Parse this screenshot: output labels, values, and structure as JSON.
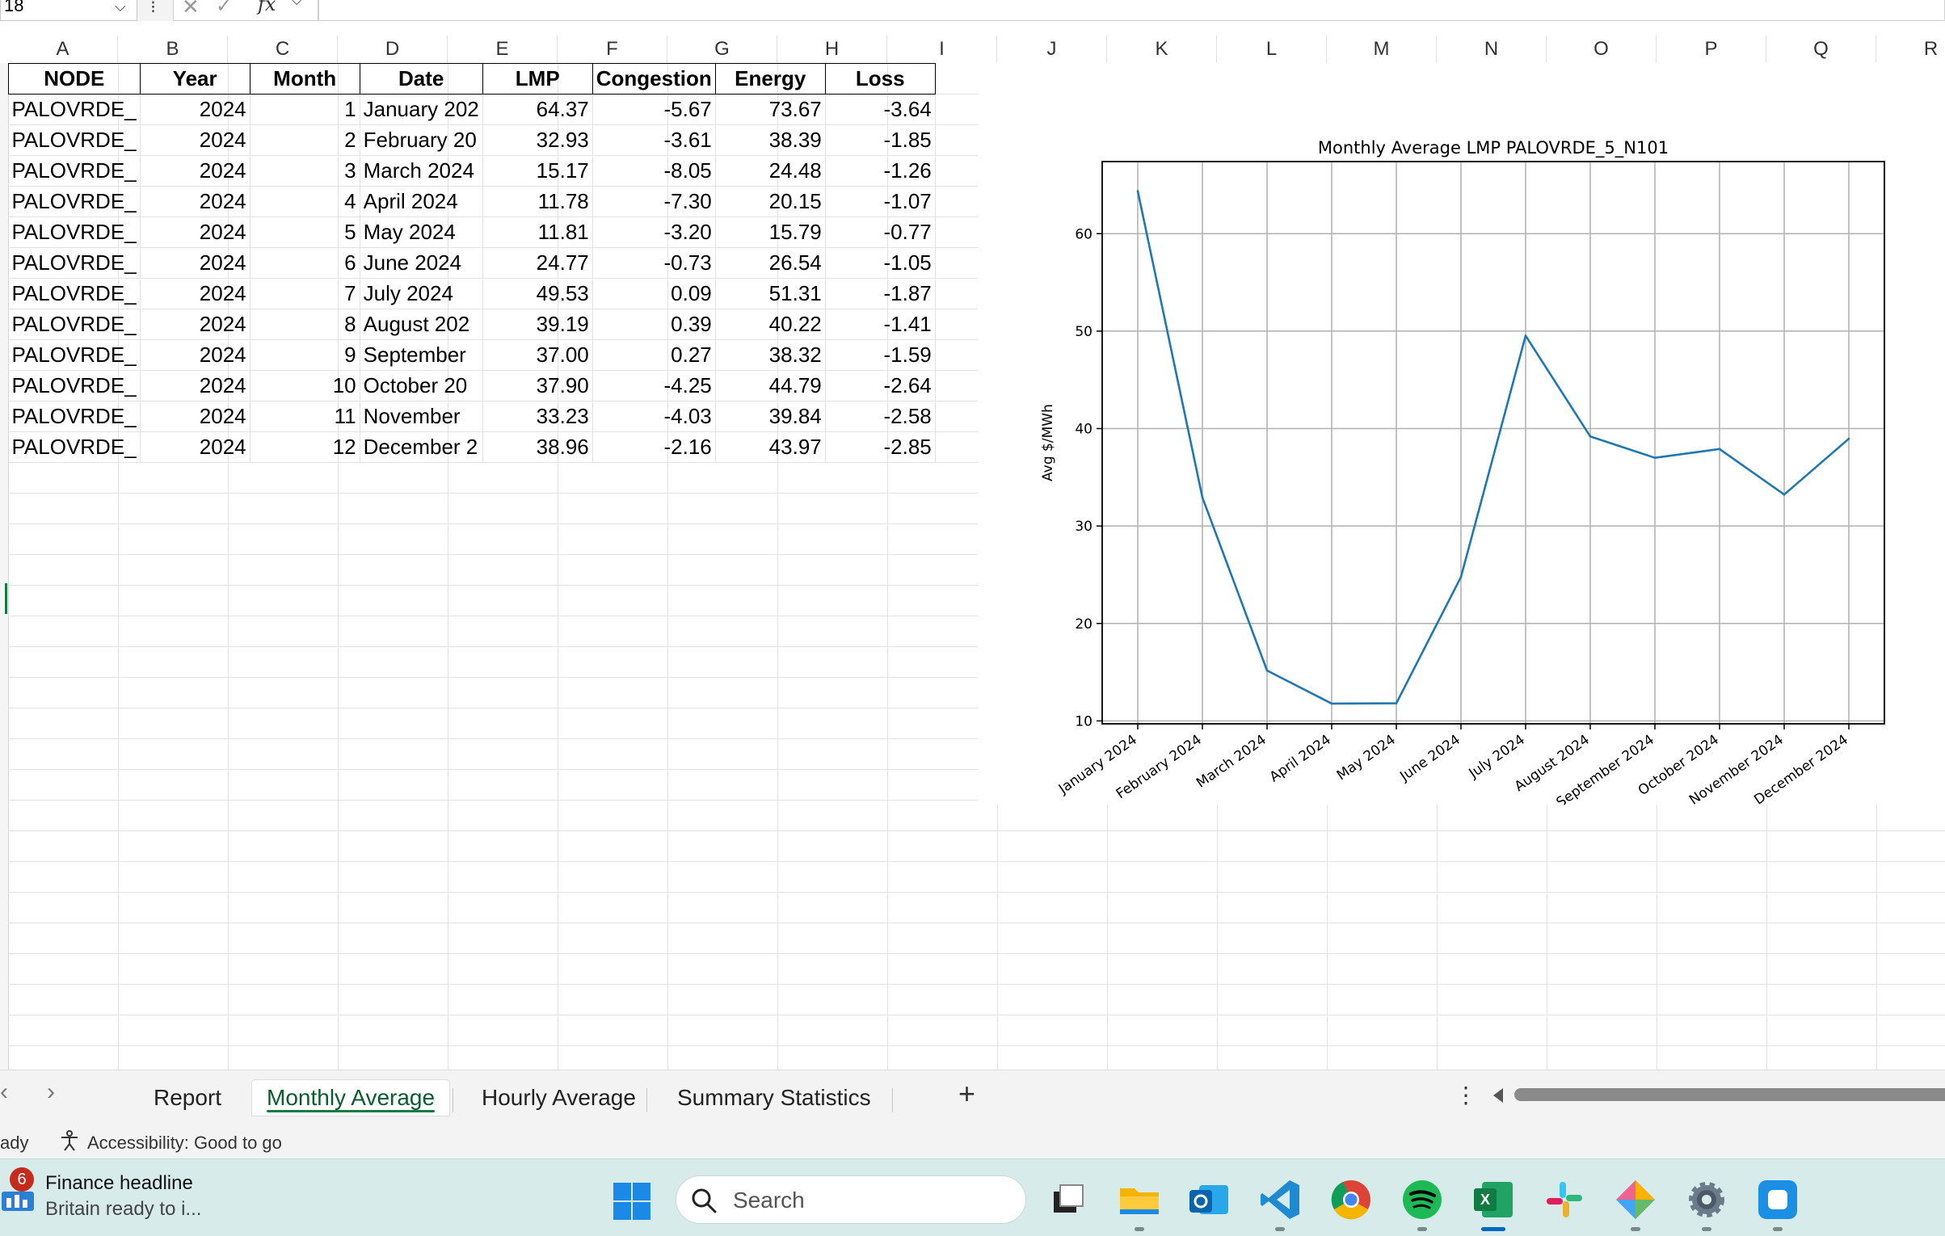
{
  "formula_bar": {
    "name_box": "18",
    "function_symbol": "fx"
  },
  "columns": [
    "A",
    "B",
    "C",
    "D",
    "E",
    "F",
    "G",
    "H",
    "I",
    "J",
    "K",
    "L",
    "M",
    "N",
    "O",
    "P",
    "Q",
    "R"
  ],
  "table": {
    "headers": [
      "NODE",
      "Year",
      "Month",
      "Date",
      "LMP",
      "Congestion",
      "Energy",
      "Loss"
    ],
    "rows": [
      [
        "PALOVRDE_",
        "2024",
        "1",
        "January 202",
        "64.37",
        "-5.67",
        "73.67",
        "-3.64"
      ],
      [
        "PALOVRDE_",
        "2024",
        "2",
        "February 20",
        "32.93",
        "-3.61",
        "38.39",
        "-1.85"
      ],
      [
        "PALOVRDE_",
        "2024",
        "3",
        "March 2024",
        "15.17",
        "-8.05",
        "24.48",
        "-1.26"
      ],
      [
        "PALOVRDE_",
        "2024",
        "4",
        "April 2024",
        "11.78",
        "-7.30",
        "20.15",
        "-1.07"
      ],
      [
        "PALOVRDE_",
        "2024",
        "5",
        "May 2024",
        "11.81",
        "-3.20",
        "15.79",
        "-0.77"
      ],
      [
        "PALOVRDE_",
        "2024",
        "6",
        "June 2024",
        "24.77",
        "-0.73",
        "26.54",
        "-1.05"
      ],
      [
        "PALOVRDE_",
        "2024",
        "7",
        "July 2024",
        "49.53",
        "0.09",
        "51.31",
        "-1.87"
      ],
      [
        "PALOVRDE_",
        "2024",
        "8",
        "August 202",
        "39.19",
        "0.39",
        "40.22",
        "-1.41"
      ],
      [
        "PALOVRDE_",
        "2024",
        "9",
        "September",
        "37.00",
        "0.27",
        "38.32",
        "-1.59"
      ],
      [
        "PALOVRDE_",
        "2024",
        "10",
        "October 20",
        "37.90",
        "-4.25",
        "44.79",
        "-2.64"
      ],
      [
        "PALOVRDE_",
        "2024",
        "11",
        "November",
        "33.23",
        "-4.03",
        "39.84",
        "-2.58"
      ],
      [
        "PALOVRDE_",
        "2024",
        "12",
        "December 2",
        "38.96",
        "-2.16",
        "43.97",
        "-2.85"
      ]
    ]
  },
  "chart_data": {
    "type": "line",
    "title": "Monthly Average LMP PALOVRDE_5_N101",
    "xlabel": "",
    "ylabel": "Avg $/MWh",
    "categories": [
      "January 2024",
      "February 2024",
      "March 2024",
      "April 2024",
      "May 2024",
      "June 2024",
      "July 2024",
      "August 2024",
      "September 2024",
      "October 2024",
      "November 2024",
      "December 2024"
    ],
    "series": [
      {
        "values": [
          64.37,
          32.93,
          15.17,
          11.78,
          11.81,
          24.77,
          49.53,
          39.19,
          37.0,
          37.9,
          33.23,
          38.96
        ],
        "color": "#1f77b4"
      }
    ],
    "yticks": [
      10,
      20,
      30,
      40,
      50,
      60
    ],
    "ylim": [
      9.7,
      67.4
    ],
    "grid": true
  },
  "sheet_tabs": [
    {
      "label": "Report",
      "active": false
    },
    {
      "label": "Monthly Average",
      "active": true
    },
    {
      "label": "Hourly Average",
      "active": false
    },
    {
      "label": "Summary Statistics",
      "active": false
    }
  ],
  "status": {
    "ready": "ady",
    "accessibility": "Accessibility: Good to go"
  },
  "taskbar": {
    "news_badge": "6",
    "news_title": "Finance headline",
    "news_subtitle": "Britain ready to i...",
    "search_label": "Search"
  }
}
